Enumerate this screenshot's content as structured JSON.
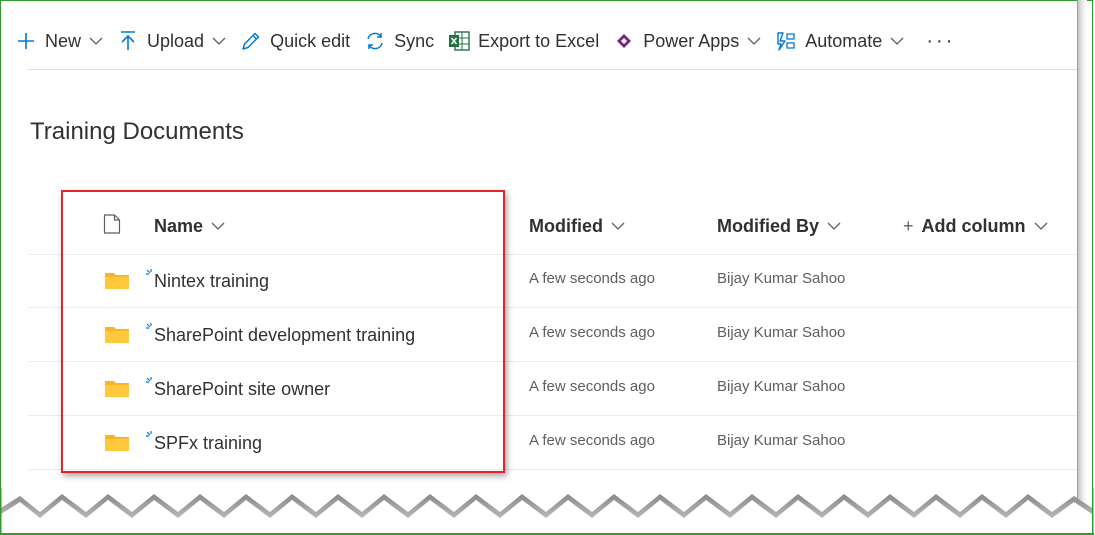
{
  "toolbar": {
    "new_label": "New",
    "upload_label": "Upload",
    "quick_edit_label": "Quick edit",
    "sync_label": "Sync",
    "export_label": "Export to Excel",
    "power_apps_label": "Power Apps",
    "automate_label": "Automate",
    "more_label": "···"
  },
  "library": {
    "title": "Training Documents"
  },
  "columns": {
    "name": "Name",
    "modified": "Modified",
    "modified_by": "Modified By",
    "add_column": "Add column"
  },
  "rows": [
    {
      "name": "Nintex training",
      "modified": "A few seconds ago",
      "modified_by": "Bijay Kumar Sahoo"
    },
    {
      "name": "SharePoint development training",
      "modified": "A few seconds ago",
      "modified_by": "Bijay Kumar Sahoo"
    },
    {
      "name": "SharePoint site owner",
      "modified": "A few seconds ago",
      "modified_by": "Bijay Kumar Sahoo"
    },
    {
      "name": "SPFx training",
      "modified": "A few seconds ago",
      "modified_by": "Bijay Kumar Sahoo"
    }
  ],
  "colors": {
    "accent": "#0078d4",
    "folder": "#ffc83d",
    "highlight_border": "#e3242b",
    "frame_border": "#2e9d2e",
    "excel_green": "#217346",
    "power_apps": "#742774"
  }
}
